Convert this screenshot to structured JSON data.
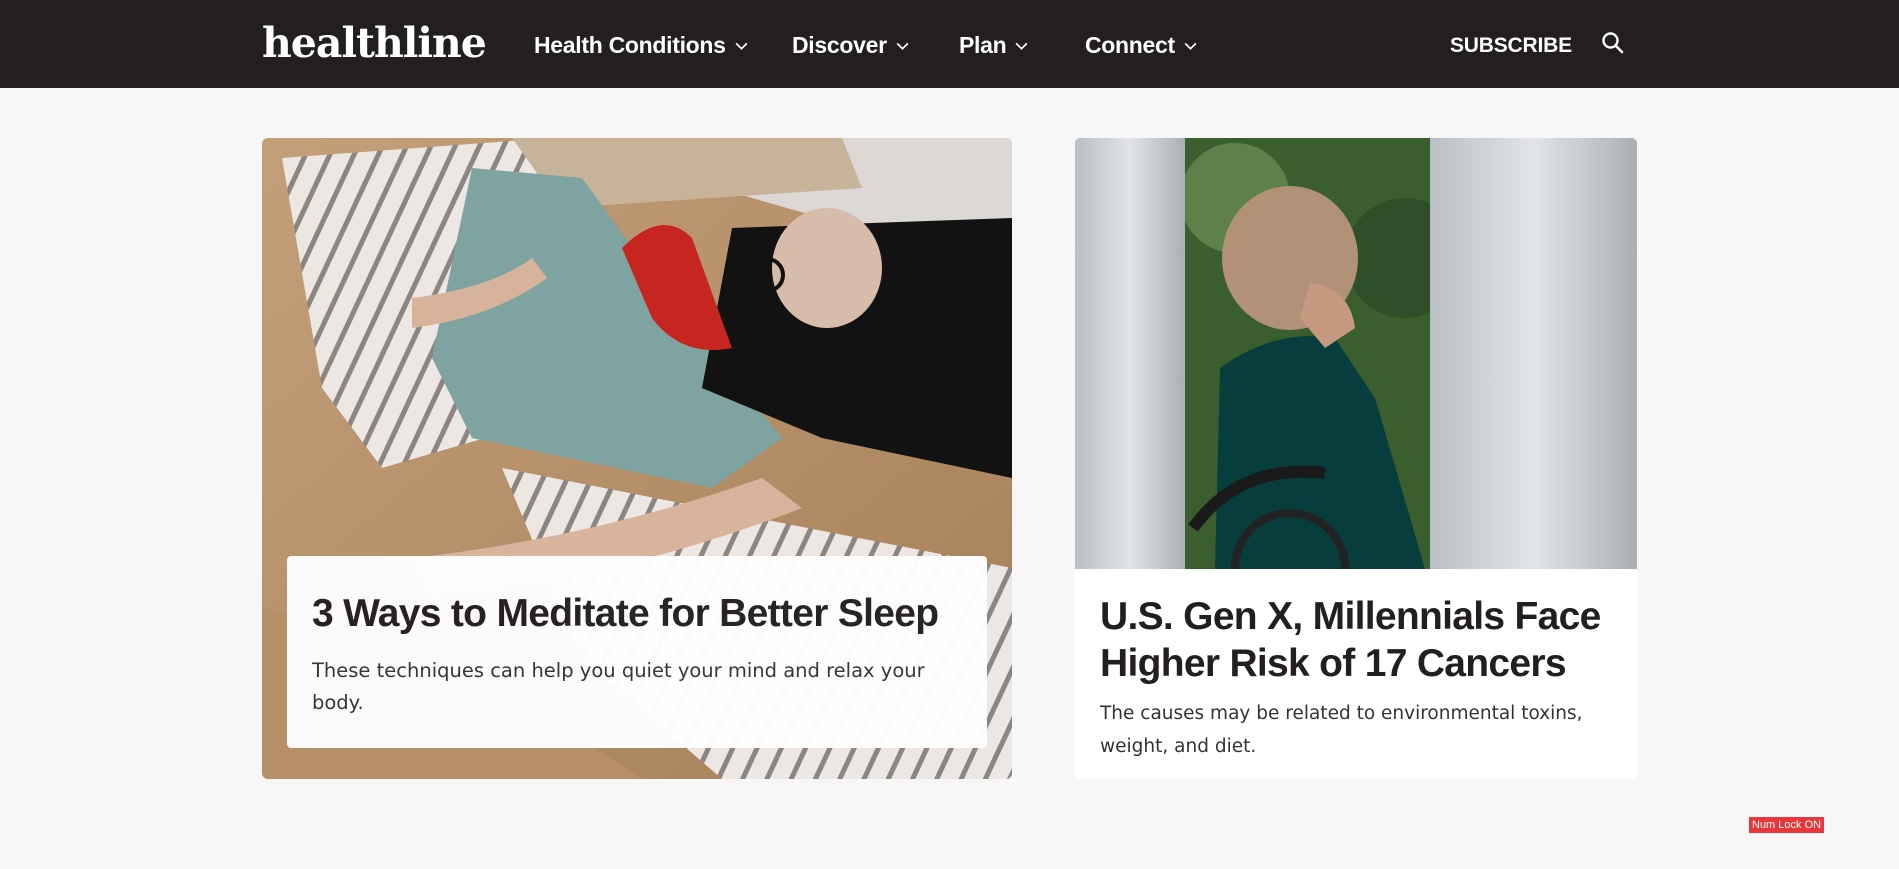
{
  "header": {
    "logo": "healthline",
    "nav": [
      {
        "label": "Health Conditions"
      },
      {
        "label": "Discover"
      },
      {
        "label": "Plan"
      },
      {
        "label": "Connect"
      }
    ],
    "subscribe_label": "SUBSCRIBE"
  },
  "cards": [
    {
      "headline": "3 Ways to Meditate for Better Sleep",
      "dek": "These techniques can help you quiet your mind and relax your body."
    },
    {
      "headline": "U.S. Gen X, Millennials Face Higher Risk of 17 Cancers",
      "dek": "The causes may be related to environmental toxins, weight, and diet."
    }
  ],
  "status": {
    "numlock": "Num Lock ON"
  },
  "colors": {
    "header_bg": "#231f20",
    "page_bg": "#f7f7f7",
    "numlock_bg": "#e8373b"
  }
}
